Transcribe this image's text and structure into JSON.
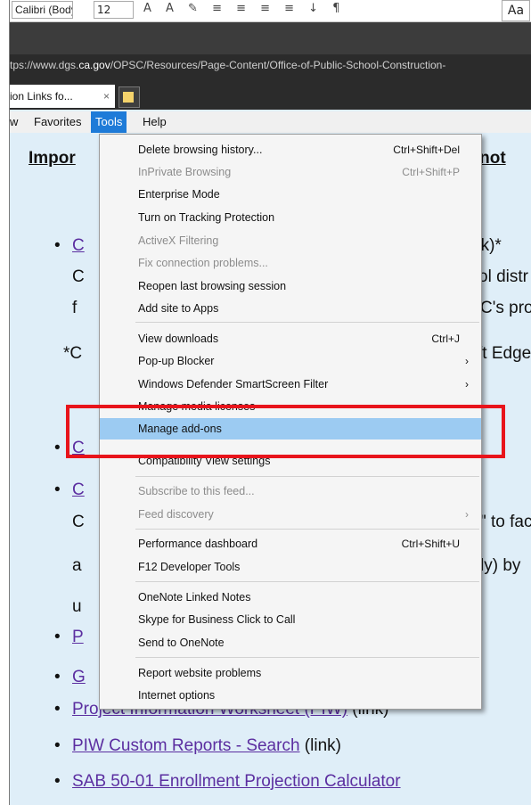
{
  "word_ribbon": {
    "font_name": "Calibri (Body)",
    "font_size": "12",
    "style_preview": "Aa"
  },
  "browser": {
    "address_prefix": "tps://www.dgs.",
    "address_domain": "ca.gov",
    "address_path": "/OPSC/Resources/Page-Content/Office-of-Public-School-Construction-",
    "tab_title": "ion Links fo...",
    "tab_close": "×"
  },
  "menubar": {
    "items": [
      "w",
      "Favorites",
      "Tools",
      "Help"
    ]
  },
  "page": {
    "heading_start": "Impor",
    "heading_end": "ill not",
    "bullet": "•",
    "line1_left": "C",
    "line1_right": "nk)*",
    "line2_left": "C",
    "line2_right": "ol distr",
    "line3_left": "f",
    "line3_right": "C's pro",
    "note_left": "*C",
    "note_right": "ft Edge",
    "link_c1": "C",
    "link_c2": "C",
    "line6_left": "C",
    "line6_right": "\" to fac",
    "line7_left": "a",
    "line7_right": "ly) by",
    "line8_left": "u",
    "link_p": "P",
    "link_g": "G",
    "link_piw": "Project Information Worksheet (PIW)",
    "link_piw_suffix": " (link)",
    "link_piw_reports": "PIW Custom Reports - Search",
    "link_piw_reports_suffix": " (link)",
    "link_sab": "SAB 50-01 Enrollment Projection Calculator"
  },
  "tools_menu": {
    "items": [
      {
        "label": "Delete browsing history...",
        "shortcut": "Ctrl+Shift+Del"
      },
      {
        "label": "InPrivate Browsing",
        "shortcut": "Ctrl+Shift+P",
        "disabled": true
      },
      {
        "label": "Enterprise Mode"
      },
      {
        "label": "Turn on Tracking Protection"
      },
      {
        "label": "ActiveX Filtering",
        "disabled": true
      },
      {
        "label": "Fix connection problems...",
        "disabled": true
      },
      {
        "label": "Reopen last browsing session"
      },
      {
        "label": "Add site to Apps"
      },
      {
        "label": "View downloads",
        "shortcut": "Ctrl+J"
      },
      {
        "label": "Pop-up Blocker",
        "submenu": true
      },
      {
        "label": "Windows Defender SmartScreen Filter",
        "submenu": true
      },
      {
        "label": "Manage media licenses"
      },
      {
        "label": "Manage add-ons",
        "highlighted": true
      },
      {
        "label": "Compatibility View settings"
      },
      {
        "label": "Subscribe to this feed...",
        "disabled": true
      },
      {
        "label": "Feed discovery",
        "disabled": true,
        "submenu": true
      },
      {
        "label": "Performance dashboard",
        "shortcut": "Ctrl+Shift+U"
      },
      {
        "label": "F12 Developer Tools"
      },
      {
        "label": "OneNote Linked Notes"
      },
      {
        "label": "Skype for Business Click to Call"
      },
      {
        "label": "Send to OneNote"
      },
      {
        "label": "Report website problems"
      },
      {
        "label": "Internet options"
      }
    ],
    "submenu_arrow": "›"
  },
  "colors": {
    "menu_highlight": "#9ccbf2",
    "annotation_box": "#e8141b",
    "tools_active": "#1e7bd8",
    "link": "#5b2ea0",
    "page_background": "#dfeef8"
  }
}
